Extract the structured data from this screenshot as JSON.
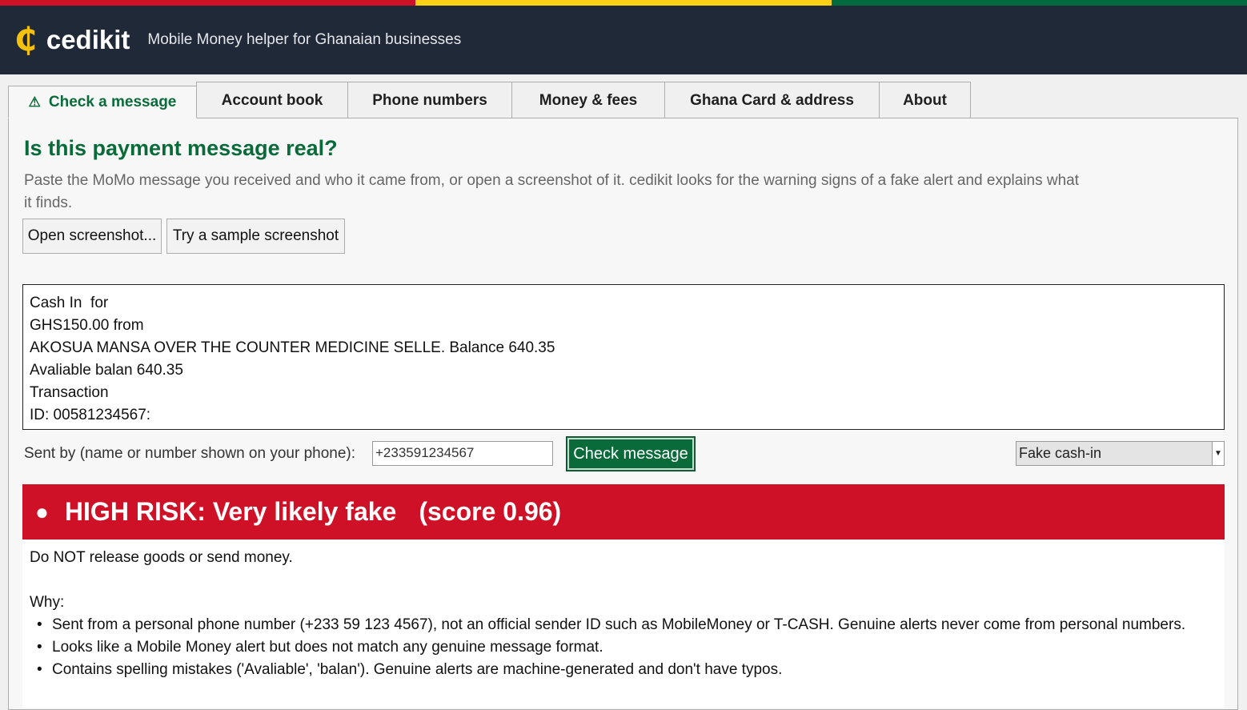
{
  "colors": {
    "flag_red": "#ce1126",
    "flag_yellow": "#fcd116",
    "flag_green": "#006b3f",
    "header_bg": "#1f2937",
    "accent_green": "#0a6b3a",
    "risk_red": "#ce1126"
  },
  "header": {
    "logo_icon": "₵",
    "app_name": "cedikit",
    "tagline": "Mobile Money helper for Ghanaian businesses"
  },
  "tabs": [
    {
      "label": "Check a message",
      "icon": "warning-icon",
      "active": true
    },
    {
      "label": "Account book"
    },
    {
      "label": "Phone numbers"
    },
    {
      "label": "Money & fees"
    },
    {
      "label": "Ghana Card & address"
    },
    {
      "label": "About"
    }
  ],
  "main": {
    "title": "Is this payment message real?",
    "description": "Paste the MoMo message you received and who it came from, or open a screenshot of it. cedikit looks for the warning signs of a fake alert and explains what it finds.",
    "open_screenshot_label": "Open screenshot...",
    "sample_screenshot_label": "Try a sample screenshot",
    "message_text": "Cash In  for\nGHS150.00 from\nAKOSUA MANSA OVER THE COUNTER MEDICINE SELLE. Balance 640.35\nAvaliable balan 640.35\nTransaction\nID: 00581234567:",
    "sent_by_label": "Sent by (name or number shown on your phone):",
    "sent_by_value": "+233591234567",
    "check_button_label": "Check message",
    "sample_select_value": "Fake cash-in"
  },
  "result": {
    "risk_dot": "●",
    "risk_label": "HIGH RISK: Very likely fake",
    "score_text": "(score 0.96)",
    "advice": "Do NOT release goods or send money.",
    "why_label": "Why:",
    "reasons": [
      "Sent from a personal phone number (+233 59 123 4567), not an official sender ID such as MobileMoney or T-CASH. Genuine alerts never come from personal numbers.",
      "Looks like a Mobile Money alert but does not match any genuine message format.",
      "Contains spelling mistakes ('Avaliable', 'balan'). Genuine alerts are machine-generated and don't have typos."
    ]
  }
}
